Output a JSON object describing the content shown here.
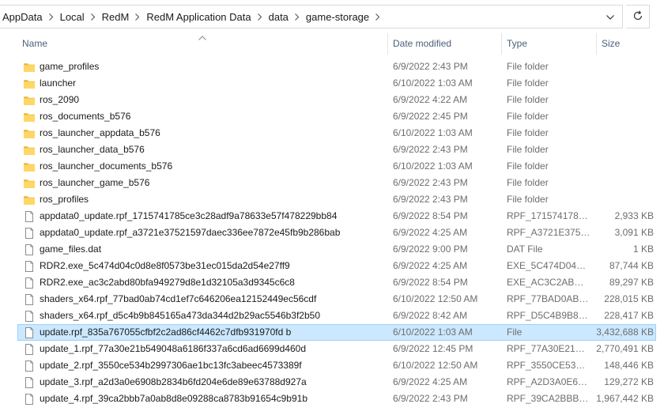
{
  "breadcrumbs": [
    "AppData",
    "Local",
    "RedM",
    "RedM Application Data",
    "data",
    "game-storage"
  ],
  "icons": {
    "separator": "chevron-right-icon",
    "dropdown": "chevron-down-icon",
    "refresh": "refresh-icon",
    "folder": "folder-icon",
    "file": "file-icon",
    "sort": "sort-ascending-icon"
  },
  "colors": {
    "folder": "#ffd766",
    "selection_bg": "#cce8ff",
    "selection_border": "#99d1ff",
    "header_text": "#4c607a"
  },
  "columns": {
    "name": "Name",
    "date": "Date modified",
    "type": "Type",
    "size": "Size"
  },
  "files": [
    {
      "name": "game_profiles",
      "date": "6/9/2022 2:43 PM",
      "type": "File folder",
      "size": "",
      "kind": "folder"
    },
    {
      "name": "launcher",
      "date": "6/10/2022 1:03 AM",
      "type": "File folder",
      "size": "",
      "kind": "folder"
    },
    {
      "name": "ros_2090",
      "date": "6/9/2022 4:22 AM",
      "type": "File folder",
      "size": "",
      "kind": "folder"
    },
    {
      "name": "ros_documents_b576",
      "date": "6/9/2022 2:45 PM",
      "type": "File folder",
      "size": "",
      "kind": "folder"
    },
    {
      "name": "ros_launcher_appdata_b576",
      "date": "6/10/2022 1:03 AM",
      "type": "File folder",
      "size": "",
      "kind": "folder"
    },
    {
      "name": "ros_launcher_data_b576",
      "date": "6/9/2022 2:43 PM",
      "type": "File folder",
      "size": "",
      "kind": "folder"
    },
    {
      "name": "ros_launcher_documents_b576",
      "date": "6/10/2022 1:03 AM",
      "type": "File folder",
      "size": "",
      "kind": "folder"
    },
    {
      "name": "ros_launcher_game_b576",
      "date": "6/9/2022 2:43 PM",
      "type": "File folder",
      "size": "",
      "kind": "folder"
    },
    {
      "name": "ros_profiles",
      "date": "6/9/2022 2:43 PM",
      "type": "File folder",
      "size": "",
      "kind": "folder"
    },
    {
      "name": "appdata0_update.rpf_1715741785ce3c28adf9a78633e57f478229bb84",
      "date": "6/9/2022 8:54 PM",
      "type": "RPF_1715741785C...",
      "size": "2,933 KB",
      "kind": "file"
    },
    {
      "name": "appdata0_update.rpf_a3721e37521597daec336ee7872e45fb9b286bab",
      "date": "6/9/2022 4:25 AM",
      "type": "RPF_A3721E37521...",
      "size": "3,091 KB",
      "kind": "file"
    },
    {
      "name": "game_files.dat",
      "date": "6/9/2022 9:00 PM",
      "type": "DAT File",
      "size": "1 KB",
      "kind": "file"
    },
    {
      "name": "RDR2.exe_5c474d04c0d8e8f0573be31ec015da2d54e27ff9",
      "date": "6/9/2022 4:25 AM",
      "type": "EXE_5C474D04C0...",
      "size": "87,744 KB",
      "kind": "file"
    },
    {
      "name": "RDR2.exe_ac3c2abd80bfa949279d8e1d32105a3d9345c6c8",
      "date": "6/9/2022 8:54 PM",
      "type": "EXE_AC3C2ABD80...",
      "size": "89,297 KB",
      "kind": "file"
    },
    {
      "name": "shaders_x64.rpf_77bad0ab74cd1ef7c646206ea12152449ec56cdf",
      "date": "6/10/2022 12:50 AM",
      "type": "RPF_77BAD0AB74...",
      "size": "228,015 KB",
      "kind": "file"
    },
    {
      "name": "shaders_x64.rpf_d5c4b9b845165a473da344d2b29ac5546b3f2b50",
      "date": "6/9/2022 8:42 AM",
      "type": "RPF_D5C4B9B8451...",
      "size": "228,417 KB",
      "kind": "file"
    },
    {
      "name": "update.rpf_835a767055cfbf2c2ad86cf4462c7dfb931970fd  b",
      "date": "6/10/2022 1:03 AM",
      "type": "File",
      "size": "3,432,688 KB",
      "kind": "file",
      "selected": true
    },
    {
      "name": "update_1.rpf_77a30e21b549048a6186f337a6cd6ad6699d460d",
      "date": "6/9/2022 12:45 PM",
      "type": "RPF_77A30E21B54...",
      "size": "2,770,491 KB",
      "kind": "file"
    },
    {
      "name": "update_2.rpf_3550ce534b2997306ae1bc13fc3abeec4573389f",
      "date": "6/10/2022 12:50 AM",
      "type": "RPF_3550CE534B2...",
      "size": "148,446 KB",
      "kind": "file"
    },
    {
      "name": "update_3.rpf_a2d3a0e6908b2834b6fd204e6de89e63788d927a",
      "date": "6/9/2022 4:25 AM",
      "type": "RPF_A2D3A0E6908...",
      "size": "129,272 KB",
      "kind": "file"
    },
    {
      "name": "update_4.rpf_39ca2bbb7a0ab8d8e09288ca8783b91654c9b91b",
      "date": "6/9/2022 2:43 PM",
      "type": "RPF_39CA2BBB7A...",
      "size": "1,967,442 KB",
      "kind": "file"
    }
  ]
}
